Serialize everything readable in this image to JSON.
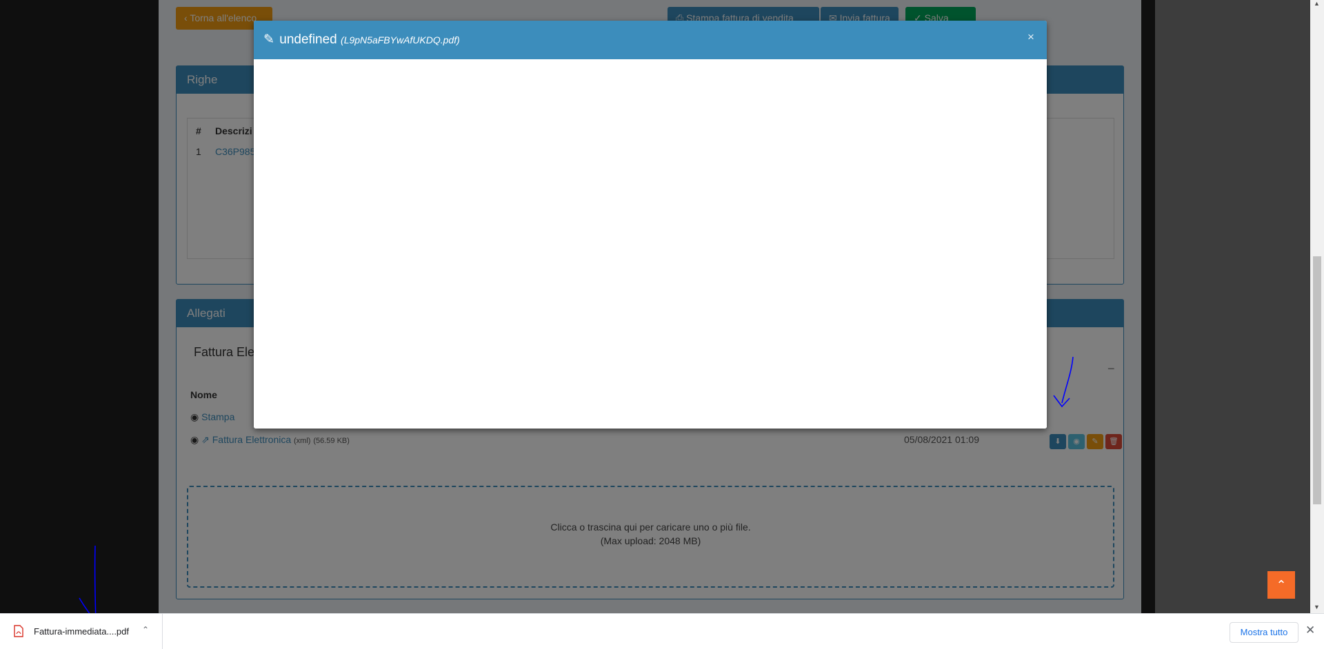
{
  "page": {
    "back_button": "Torna all'elenco",
    "print_button": "Stampa fattura di vendita",
    "send_button": "Invia fattura",
    "save_button": "Salva"
  },
  "righe": {
    "title": "Righe",
    "col_num": "#",
    "col_desc": "Descrizi",
    "row1_num": "1",
    "row1_code": "C36P985"
  },
  "allegati": {
    "title": "Allegati",
    "category": "Fattura Ele",
    "col_name": "Nome",
    "col_actions": "#",
    "collapse": "−",
    "files": [
      {
        "name": "Stampa",
        "ext": "",
        "size": "",
        "date": ""
      },
      {
        "name": "Fattura Elettronica",
        "ext": "(xml)",
        "size": "(56.59 KB)",
        "date": "05/08/2021 01:09"
      }
    ],
    "dropzone_line1": "Clicca o trascina qui per caricare uno o più file.",
    "dropzone_line2": "(Max upload: 2048 MB)"
  },
  "modal": {
    "title": "undefined",
    "filename": "(L9pN5aFBYwAfUKDQ.pdf)",
    "close": "×"
  },
  "downloads": {
    "file_name": "Fattura-immediata....pdf",
    "show_all": "Mostra tutto",
    "close": "✕"
  },
  "colors": {
    "primary": "#3c8dbc",
    "warning": "#f39c12",
    "success": "#00a65a",
    "danger": "#dd4b39",
    "annotation": "#0000ff"
  }
}
